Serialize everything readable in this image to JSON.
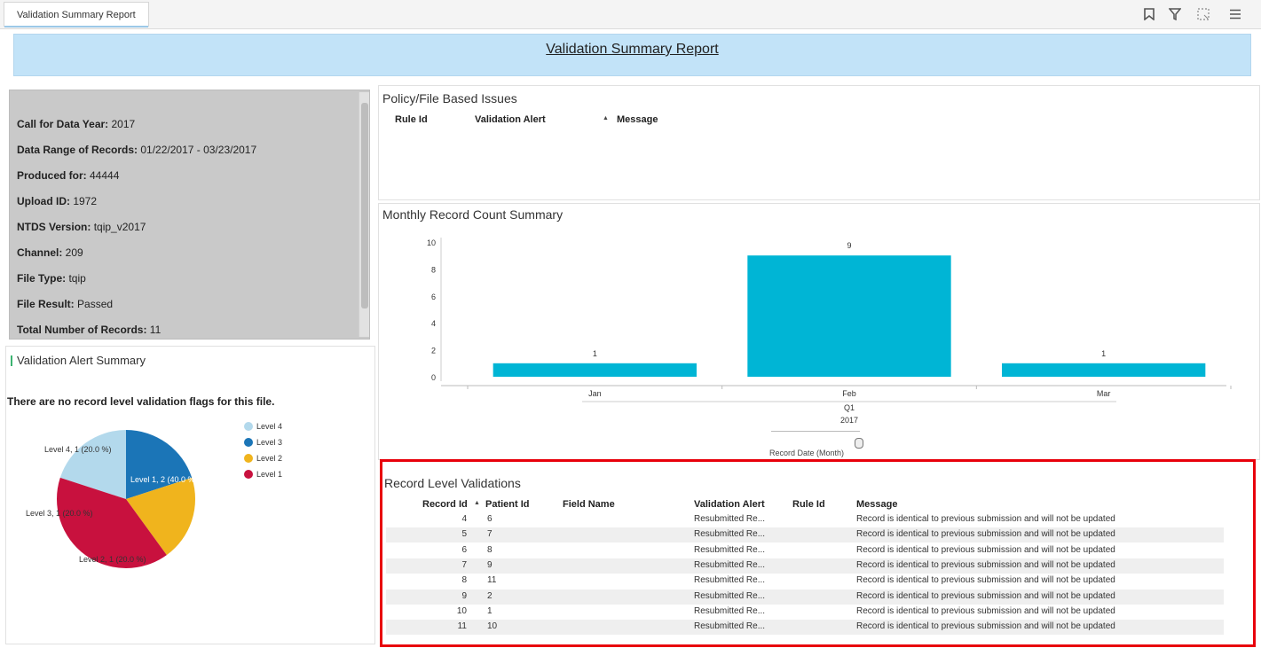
{
  "tab": {
    "label": "Validation Summary Report"
  },
  "toolbar": {
    "icons": [
      "bookmark-icon",
      "filter-icon",
      "fullscreen-icon",
      "menu-icon"
    ]
  },
  "banner": {
    "title": "Validation Summary Report"
  },
  "info": {
    "rows": [
      {
        "label": "Call for Data Year:",
        "value": " 2017"
      },
      {
        "label": "Data Range of Records:",
        "value": " 01/22/2017 - 03/23/2017"
      },
      {
        "label": "Produced for:",
        "value": " 44444"
      },
      {
        "label": "Upload ID:",
        "value": " 1972"
      },
      {
        "label": "NTDS Version:",
        "value": " tqip_v2017"
      },
      {
        "label": "Channel:",
        "value": " 209"
      },
      {
        "label": "File Type:",
        "value": " tqip"
      },
      {
        "label": "File Result:",
        "value": " Passed"
      },
      {
        "label": "Total Number of Records:",
        "value": " 11"
      }
    ]
  },
  "alert_summary": {
    "title": "Validation Alert Summary",
    "message": "There are no record level validation flags for this file.",
    "legend": [
      {
        "label": "Level 4",
        "color": "#b3d9ec"
      },
      {
        "label": "Level 3",
        "color": "#1b75b7"
      },
      {
        "label": "Level 2",
        "color": "#f0b41d"
      },
      {
        "label": "Level 1",
        "color": "#c8113e"
      }
    ],
    "slice_labels": [
      "Level 4, 1 (20.0 %)",
      "Level 3, 1 (20.0 %)",
      "Level 2, 1 (20.0 %)",
      "Level 1, 2 (40.0 %)"
    ]
  },
  "chart_data": [
    {
      "type": "pie",
      "labels": [
        "Level 4",
        "Level 3",
        "Level 2",
        "Level 1"
      ],
      "values": [
        1,
        1,
        1,
        2
      ],
      "percent": [
        20.0,
        20.0,
        20.0,
        40.0
      ],
      "colors": [
        "#b3d9ec",
        "#1b75b7",
        "#f0b41d",
        "#c8113e"
      ],
      "legend": "right"
    },
    {
      "type": "bar",
      "title": "Monthly Record Count Summary",
      "categories": [
        "Jan",
        "Feb",
        "Mar"
      ],
      "values": [
        1,
        9,
        1
      ],
      "ylim": [
        0,
        10
      ],
      "yticks": [
        "0",
        "2",
        "4",
        "6",
        "8",
        "10"
      ],
      "group_labels": [
        "Q1",
        "2017"
      ],
      "xlabel": "Record Date (Month)",
      "color": "#00b5d5"
    }
  ],
  "policy": {
    "title": "Policy/File Based Issues",
    "columns": [
      "Rule Id",
      "Validation Alert",
      "Message"
    ],
    "sort_indicator": "▲"
  },
  "record_level": {
    "title": "Record Level Validations",
    "columns": [
      "Record Id",
      "Patient Id",
      "Field Name",
      "Validation Alert",
      "Rule Id",
      "Message"
    ],
    "sort_indicator": "▲",
    "rows": [
      {
        "record_id": "4",
        "patient_id": "6",
        "alert": "Resubmitted Re...",
        "message": "Record is identical to previous submission and will not be updated"
      },
      {
        "record_id": "5",
        "patient_id": "7",
        "alert": "Resubmitted Re...",
        "message": "Record is identical to previous submission and will not be updated"
      },
      {
        "record_id": "6",
        "patient_id": "8",
        "alert": "Resubmitted Re...",
        "message": "Record is identical to previous submission and will not be updated"
      },
      {
        "record_id": "7",
        "patient_id": "9",
        "alert": "Resubmitted Re...",
        "message": "Record is identical to previous submission and will not be updated"
      },
      {
        "record_id": "8",
        "patient_id": "11",
        "alert": "Resubmitted Re...",
        "message": "Record is identical to previous submission and will not be updated"
      },
      {
        "record_id": "9",
        "patient_id": "2",
        "alert": "Resubmitted Re...",
        "message": "Record is identical to previous submission and will not be updated"
      },
      {
        "record_id": "10",
        "patient_id": "1",
        "alert": "Resubmitted Re...",
        "message": "Record is identical to previous submission and will not be updated"
      },
      {
        "record_id": "11",
        "patient_id": "10",
        "alert": "Resubmitted Re...",
        "message": "Record is identical to previous submission and will not be updated"
      }
    ]
  },
  "colors": {
    "highlight_border": "#e8000b",
    "banner_bg": "#c2e3f8",
    "info_bg": "#c9c9c9"
  }
}
